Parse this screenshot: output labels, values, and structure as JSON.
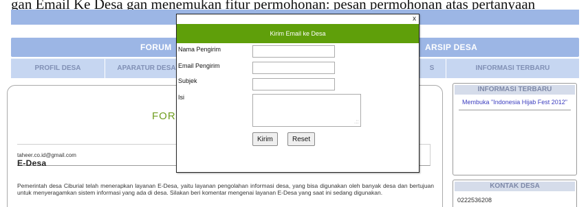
{
  "background_text": "gan Email Ke Desa gan menemukan fitur permohonan: pesan permohonan atas pertanyaan",
  "nav_title": {
    "forum": "FORUM",
    "arsip": "ARSIP DESA"
  },
  "nav": {
    "items": [
      {
        "label": "PROFIL DESA"
      },
      {
        "label": "APARATUR DESA"
      },
      {
        "label": "S"
      },
      {
        "label": "INFORMASI TERBARU"
      }
    ]
  },
  "main": {
    "heading": "FORUM",
    "inner_email": "taheer.co.id@gmail.com",
    "inner_title": "E-Desa",
    "description": "Pemerintah desa Ciburial telah menerapkan layanan E-Desa, yaitu layanan pengolahan informasi desa, yang bisa digunakan oleh banyak desa dan bertujuan untuk menyeragamkan sistem informasi yang ada di desa. Silakan beri komentar mengenai layanan E-Desa yang saat ini sedang digunakan."
  },
  "sidebar": {
    "info_title": "INFORMASI TERBARU",
    "info_link": "Membuka \"Indonesia Hijab Fest 2012\"",
    "contact_title": "KONTAK DESA",
    "phone": "0222536208"
  },
  "modal": {
    "close_label": "x",
    "title": "Kirim Email ke Desa",
    "fields": {
      "sender_name": {
        "label": "Nama Pengirim",
        "value": ""
      },
      "sender_email": {
        "label": "Email Pengirim",
        "value": ""
      },
      "subject": {
        "label": "Subjek",
        "value": ""
      },
      "body": {
        "label": "Isi",
        "value": ""
      }
    },
    "buttons": {
      "send": "Kirim",
      "reset": "Reset"
    }
  },
  "colors": {
    "accent_green": "#5f9f0a",
    "band_blue": "#9cb6e5",
    "nav_blue": "#c6d6f1",
    "link_blue": "#3b3dbf"
  }
}
